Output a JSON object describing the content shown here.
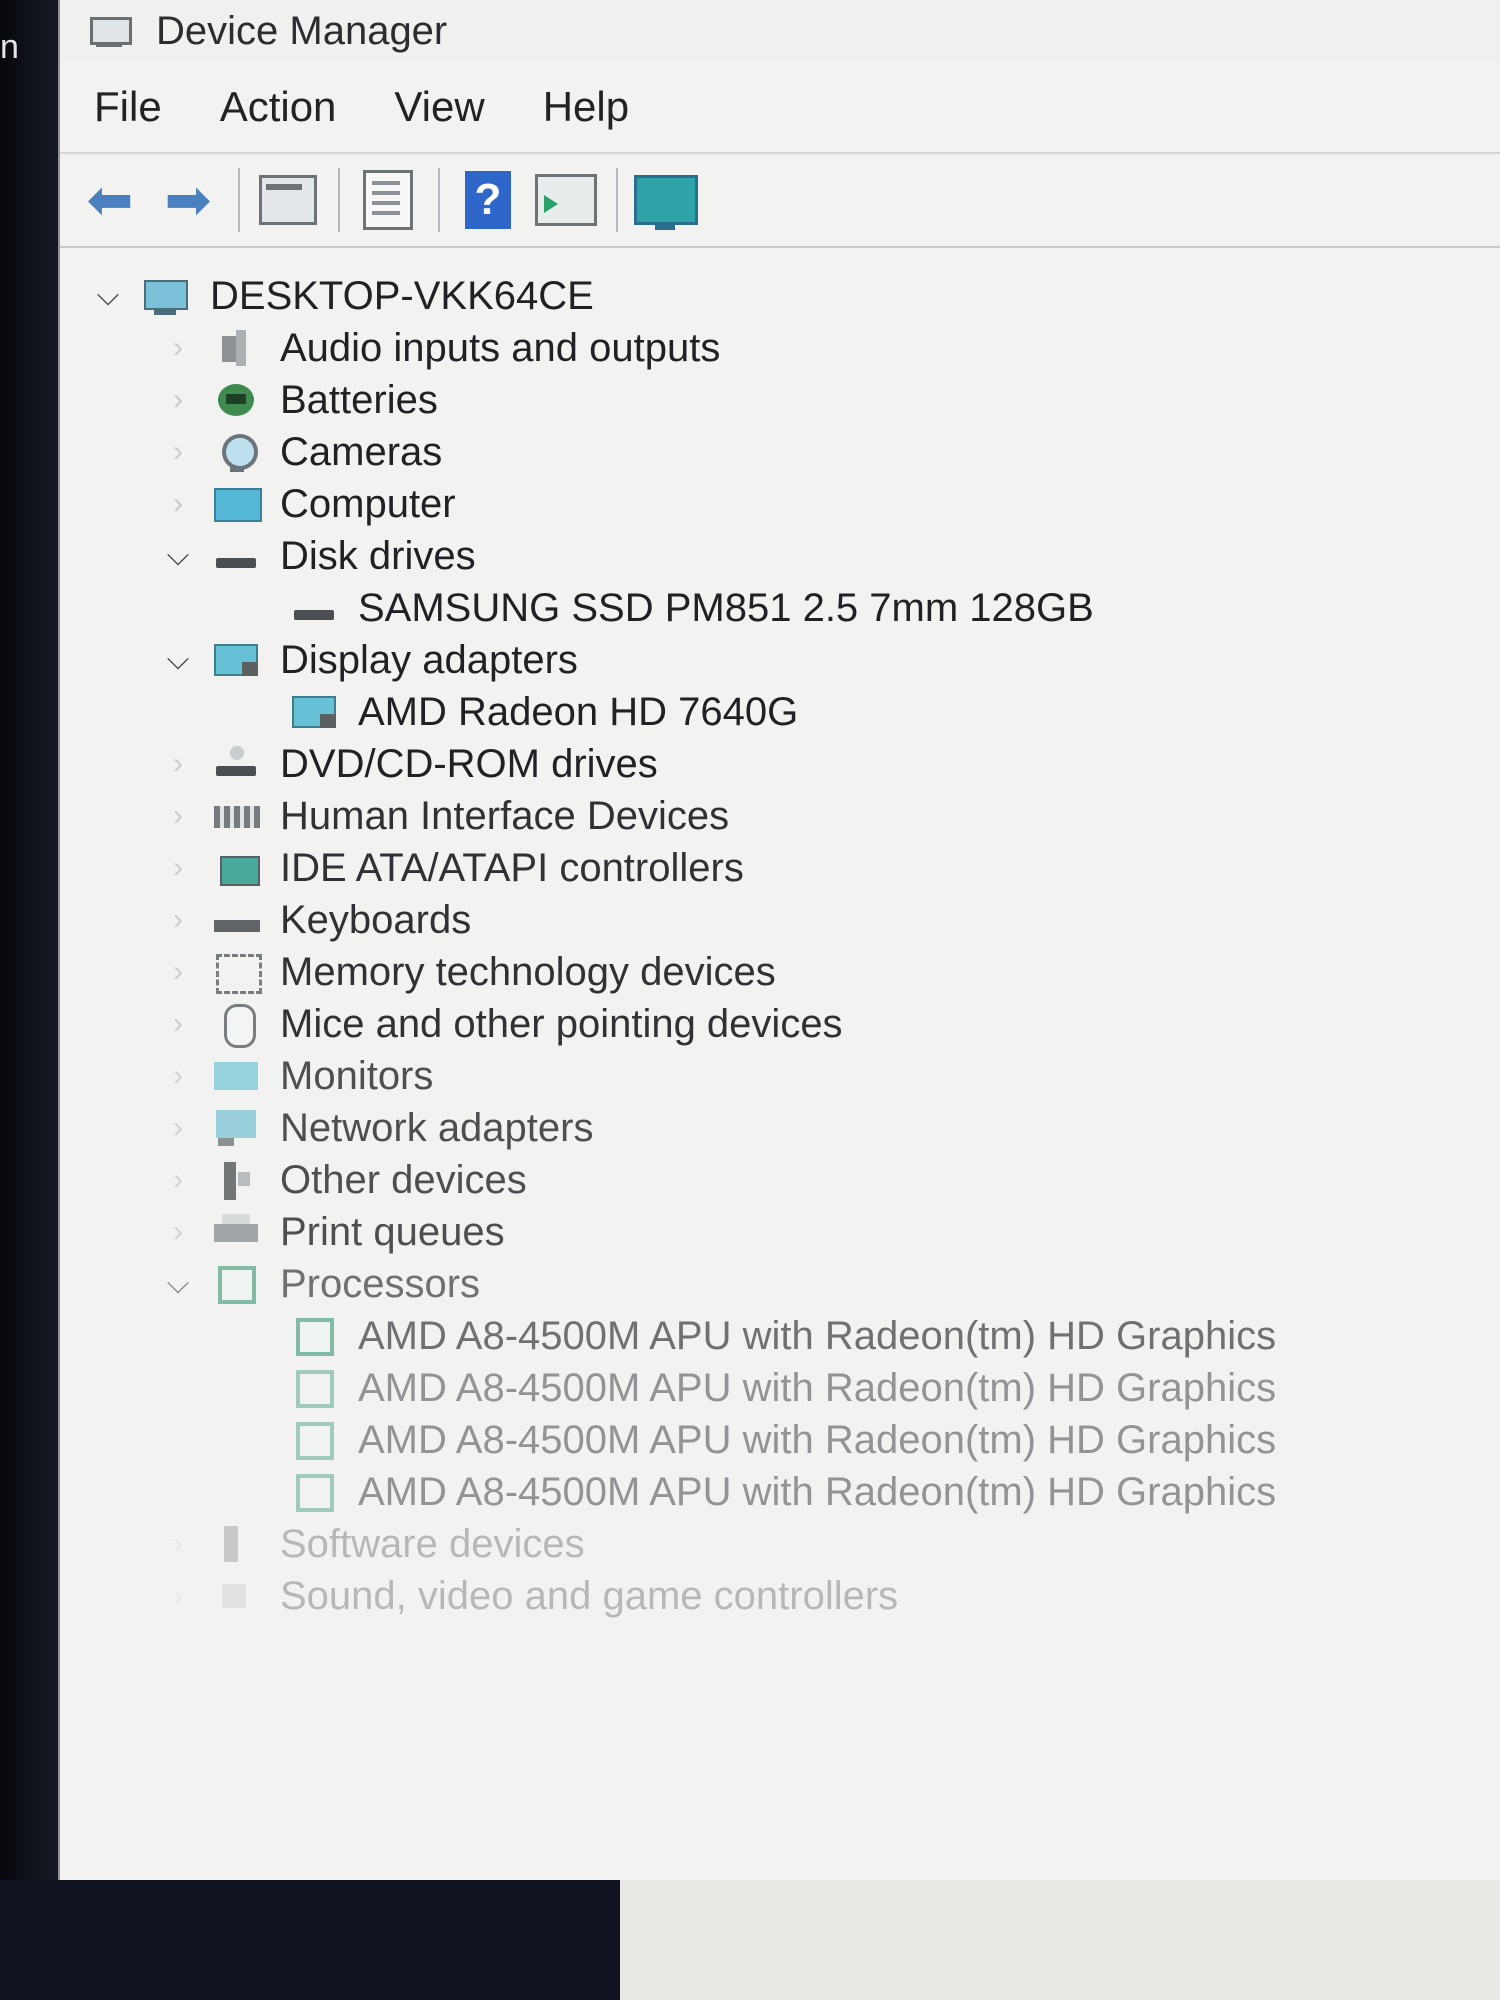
{
  "window": {
    "title": "Device Manager",
    "left_glyph": "n"
  },
  "menu": [
    "File",
    "Action",
    "View",
    "Help"
  ],
  "toolbar": {
    "buttons": [
      {
        "name": "back-arrow-icon"
      },
      {
        "name": "forward-arrow-icon"
      },
      {
        "name": "properties-icon"
      },
      {
        "name": "device-list-icon"
      },
      {
        "name": "help-icon",
        "glyph": "?"
      },
      {
        "name": "update-driver-icon"
      },
      {
        "name": "monitor-icon"
      }
    ]
  },
  "tree": {
    "root": "DESKTOP-VKK64CE",
    "categories": [
      {
        "label": "Audio inputs and outputs",
        "icon": "audio",
        "expanded": false
      },
      {
        "label": "Batteries",
        "icon": "battery",
        "expanded": false
      },
      {
        "label": "Cameras",
        "icon": "camera",
        "expanded": false
      },
      {
        "label": "Computer",
        "icon": "computer",
        "expanded": false
      },
      {
        "label": "Disk drives",
        "icon": "disk",
        "expanded": true,
        "children": [
          "SAMSUNG SSD PM851 2.5 7mm 128GB"
        ]
      },
      {
        "label": "Display adapters",
        "icon": "display",
        "expanded": true,
        "children": [
          "AMD Radeon HD 7640G"
        ]
      },
      {
        "label": "DVD/CD-ROM drives",
        "icon": "dvd",
        "expanded": false
      },
      {
        "label": "Human Interface Devices",
        "icon": "hid",
        "expanded": false
      },
      {
        "label": "IDE ATA/ATAPI controllers",
        "icon": "ide",
        "expanded": false
      },
      {
        "label": "Keyboards",
        "icon": "kbd",
        "expanded": false
      },
      {
        "label": "Memory technology devices",
        "icon": "mem",
        "expanded": false
      },
      {
        "label": "Mice and other pointing devices",
        "icon": "mouse",
        "expanded": false
      },
      {
        "label": "Monitors",
        "icon": "monitor",
        "expanded": false
      },
      {
        "label": "Network adapters",
        "icon": "net",
        "expanded": false
      },
      {
        "label": "Other devices",
        "icon": "other",
        "expanded": false
      },
      {
        "label": "Print queues",
        "icon": "print",
        "expanded": false
      },
      {
        "label": "Processors",
        "icon": "cpu",
        "expanded": true,
        "children": [
          "AMD A8-4500M APU with Radeon(tm) HD Graphics",
          "AMD A8-4500M APU with Radeon(tm) HD Graphics",
          "AMD A8-4500M APU with Radeon(tm) HD Graphics",
          "AMD A8-4500M APU with Radeon(tm) HD Graphics"
        ]
      },
      {
        "label": "Software devices",
        "icon": "soft",
        "expanded": false
      },
      {
        "label": "Sound, video and game controllers",
        "icon": "sound",
        "expanded": false
      }
    ]
  }
}
